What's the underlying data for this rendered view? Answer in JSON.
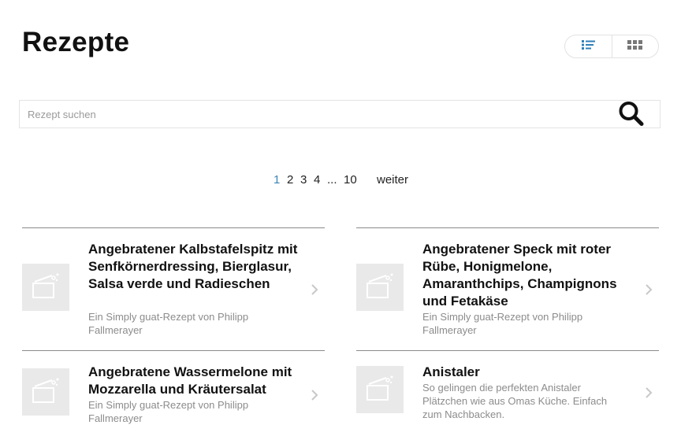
{
  "page": {
    "title": "Rezepte"
  },
  "view_toggle": {
    "list_icon": "list-view-icon",
    "grid_icon": "grid-view-icon",
    "active_color": "#2f7fb8",
    "inactive_color": "#777777"
  },
  "search": {
    "placeholder": "Rezept suchen",
    "value": "",
    "icon": "search-icon"
  },
  "pagination": {
    "pages": [
      "1",
      "2",
      "3",
      "4"
    ],
    "current": "1",
    "ellipsis": "...",
    "last": "10",
    "next": "weiter",
    "active_color": "#3a83b7"
  },
  "recipes": [
    {
      "title": "Angebratener Kalbstafelspitz mit Senfkörnerdressing, Bierglasur, Salsa verde und Radieschen",
      "subtitle": "Ein Simply guat-Rezept von Philipp Fallmerayer",
      "icon": "cooking-pot-icon"
    },
    {
      "title": "Angebratener Speck mit roter Rübe, Honigmelone, Amaranthchips, Champignons und Fetakäse",
      "subtitle": "Ein Simply guat-Rezept von Philipp Fallmerayer",
      "icon": "cooking-pot-icon"
    },
    {
      "title": "Angebratene Wassermelone mit Mozzarella und Kräutersalat",
      "subtitle": "Ein Simply guat-Rezept von Philipp Fallmerayer",
      "icon": "cooking-pot-icon"
    },
    {
      "title": "Anistaler",
      "subtitle": "So gelingen die perfekten Anistaler Plätzchen wie aus Omas Küche. Einfach zum Nachbacken.",
      "icon": "cooking-pot-icon"
    }
  ]
}
